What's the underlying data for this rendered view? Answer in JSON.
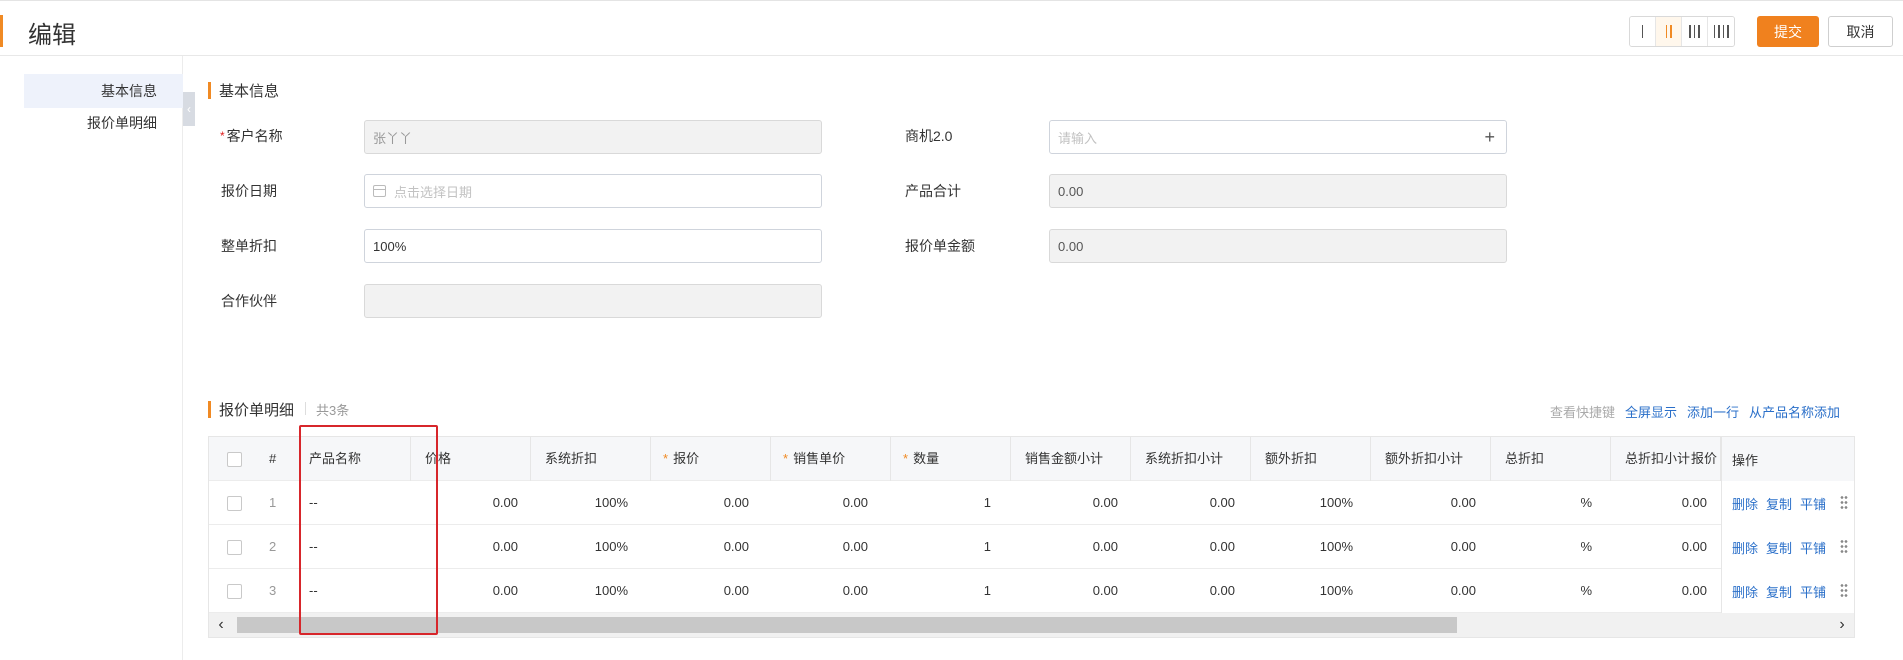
{
  "header": {
    "title": "编辑",
    "layout_options": [
      "single-column",
      "two-column",
      "three-column",
      "four-column"
    ],
    "active_layout": "two-column",
    "submit_label": "提交",
    "cancel_label": "取消",
    "accent_color": "#f0811e"
  },
  "sidebar": {
    "items": [
      {
        "label": "基本信息",
        "active": true
      },
      {
        "label": "报价单明细",
        "active": false
      }
    ],
    "collapse_icon": "chevron-left-icon"
  },
  "basic_info": {
    "section_title": "基本信息",
    "fields": {
      "customer": {
        "label": "客户名称",
        "required": true,
        "value": "张丫丫",
        "disabled": true
      },
      "opportunity": {
        "label": "商机2.0",
        "placeholder": "请输入",
        "icon": "plus-icon"
      },
      "quote_date": {
        "label": "报价日期",
        "placeholder": "点击选择日期",
        "icon": "calendar-icon"
      },
      "product_total": {
        "label": "产品合计",
        "value": "0.00",
        "disabled": true
      },
      "discount": {
        "label": "整单折扣",
        "value": "100%"
      },
      "quote_amount": {
        "label": "报价单金额",
        "value": "0.00",
        "disabled": true
      },
      "partner": {
        "label": "合作伙伴",
        "value": "",
        "disabled": true
      }
    }
  },
  "details": {
    "section_title": "报价单明细",
    "count_text": "共3条",
    "actions": {
      "shortcuts": "查看快捷键",
      "fullscreen": "全屏显示",
      "add_row": "添加一行",
      "add_from_product": "从产品名称添加"
    },
    "columns": {
      "index": "#",
      "product_name": "产品名称",
      "price": "价格",
      "sys_discount": "系统折扣",
      "quote": "报价",
      "unit_price": "销售单价",
      "qty": "数量",
      "sales_subtotal": "销售金额小计",
      "sys_discount_subtotal": "系统折扣小计",
      "extra_discount": "额外折扣",
      "extra_discount_subtotal": "额外折扣小计",
      "total_discount": "总折扣",
      "total_discount_subtotal": "总折扣小计",
      "quote_cut": "报价",
      "ops": "操作"
    },
    "rows": [
      {
        "index": "1",
        "product_name": "--",
        "price": "0.00",
        "sys_discount": "100%",
        "quote": "0.00",
        "unit_price": "0.00",
        "qty": "1",
        "sales_subtotal": "0.00",
        "sys_discount_subtotal": "0.00",
        "extra_discount": "100%",
        "extra_discount_subtotal": "0.00",
        "total_discount": "%",
        "total_discount_subtotal": "0.00"
      },
      {
        "index": "2",
        "product_name": "--",
        "price": "0.00",
        "sys_discount": "100%",
        "quote": "0.00",
        "unit_price": "0.00",
        "qty": "1",
        "sales_subtotal": "0.00",
        "sys_discount_subtotal": "0.00",
        "extra_discount": "100%",
        "extra_discount_subtotal": "0.00",
        "total_discount": "%",
        "total_discount_subtotal": "0.00"
      },
      {
        "index": "3",
        "product_name": "--",
        "price": "0.00",
        "sys_discount": "100%",
        "quote": "0.00",
        "unit_price": "0.00",
        "qty": "1",
        "sales_subtotal": "0.00",
        "sys_discount_subtotal": "0.00",
        "extra_discount": "100%",
        "extra_discount_subtotal": "0.00",
        "total_discount": "%",
        "total_discount_subtotal": "0.00"
      }
    ],
    "row_actions": {
      "delete": "删除",
      "copy": "复制",
      "tile": "平铺"
    },
    "highlight_color": "#d7262b"
  }
}
